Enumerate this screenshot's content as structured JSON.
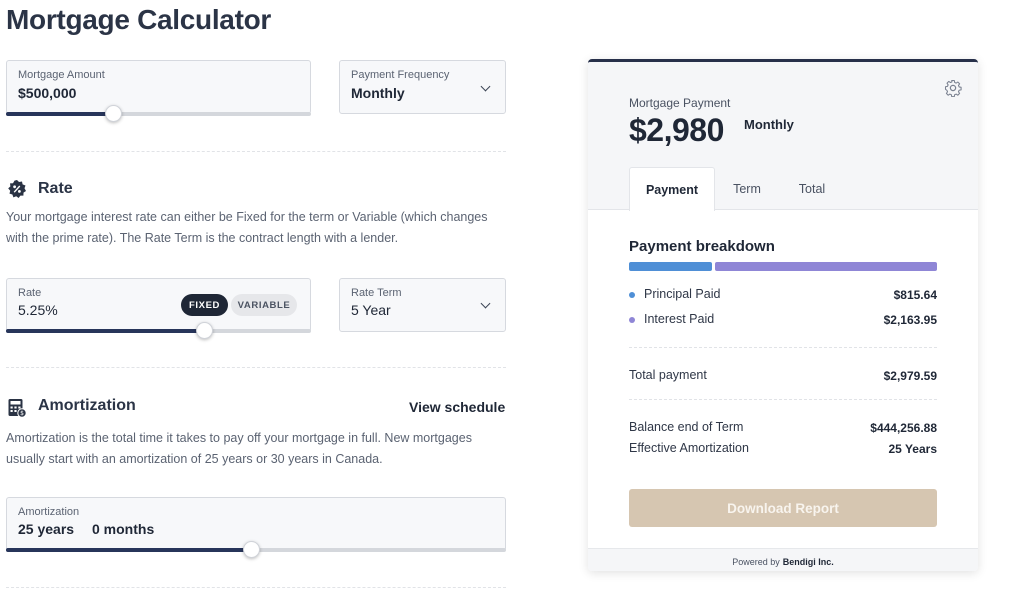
{
  "page": {
    "title": "Mortgage Calculator"
  },
  "mortgage": {
    "amount_label": "Mortgage Amount",
    "amount_value": "$500,000",
    "amount_slider_fraction": 0.35,
    "frequency_label": "Payment Frequency",
    "frequency_value": "Monthly"
  },
  "rate_section": {
    "heading": "Rate",
    "description": "Your mortgage interest rate can either be Fixed for the term or Variable (which changes with the prime rate). The Rate Term is the contract length with a lender.",
    "rate_label": "Rate",
    "rate_value": "5.25%",
    "fixed_label": "FIXED",
    "variable_label": "VARIABLE",
    "selected_type": "FIXED",
    "rate_slider_fraction": 0.65,
    "term_label": "Rate Term",
    "term_value": "5 Year"
  },
  "amortization_section": {
    "heading": "Amortization",
    "view_schedule_label": "View schedule",
    "description": "Amortization is the total time it takes to pay off your mortgage in full. New mortgages usually start with an amortization of 25 years or 30 years in Canada.",
    "field_label": "Amortization",
    "years_value": "25 years",
    "months_value": "0 months",
    "slider_fraction": 0.49
  },
  "summary": {
    "payment_label": "Mortgage Payment",
    "payment_amount": "$2,980",
    "payment_frequency": "Monthly",
    "tabs": [
      {
        "label": "Payment",
        "active": true
      },
      {
        "label": "Term",
        "active": false
      },
      {
        "label": "Total",
        "active": false
      }
    ],
    "breakdown_title": "Payment breakdown",
    "principal_label": "Principal Paid",
    "principal_value": "$815.64",
    "interest_label": "Interest Paid",
    "interest_value": "$2,163.95",
    "principal_fraction": 0.2737,
    "principal_color": "#4f8fd6",
    "interest_color": "#8f86d6",
    "total_label": "Total payment",
    "total_value": "$2,979.59",
    "balance_label": "Balance end of Term",
    "balance_value": "$444,256.88",
    "effective_label": "Effective Amortization",
    "effective_value": "25 Years",
    "download_label": "Download Report",
    "powered_by_prefix": "Powered by",
    "powered_by_name": "Bendigi Inc."
  },
  "icons": {
    "rate": "percent-badge-icon",
    "amortization": "calculator-icon",
    "settings": "gear-icon",
    "dropdown": "chevron-down-icon"
  }
}
